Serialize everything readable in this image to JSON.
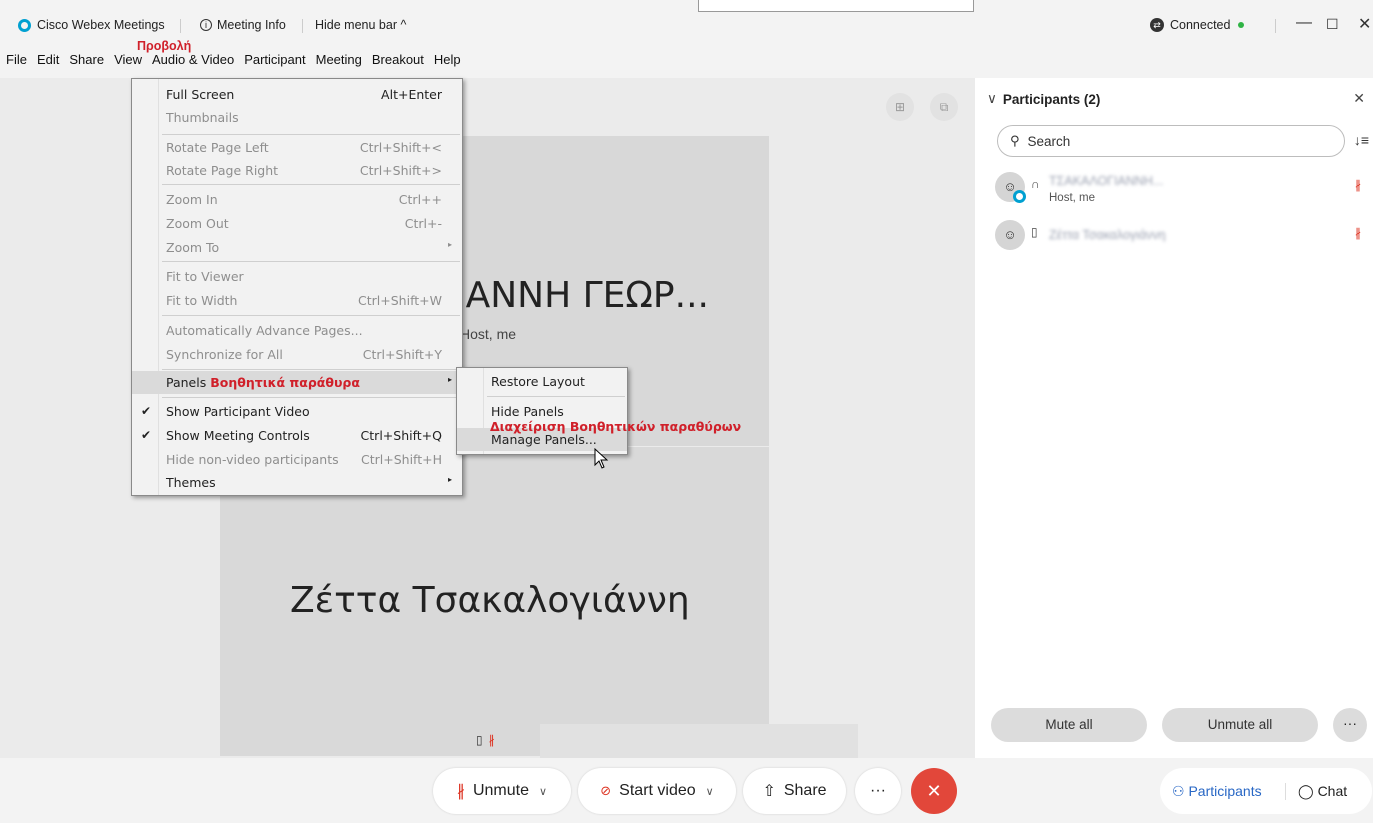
{
  "titlebar": {
    "app_name": "Cisco Webex Meetings",
    "meeting_info": "Meeting Info",
    "hide_menu_bar": "Hide menu bar",
    "hide_menu_chevron": "^",
    "connection_status": "Connected",
    "status_color": "#2fb344",
    "brand_color": "#00a0d1"
  },
  "annotation_view": "Προβολή",
  "menubar": {
    "items": [
      "File",
      "Edit",
      "Share",
      "View",
      "Audio & Video",
      "Participant",
      "Meeting",
      "Breakout",
      "Help"
    ]
  },
  "view_menu": {
    "full_screen": {
      "label": "Full Screen",
      "shortcut": "Alt+Enter"
    },
    "thumbnails": {
      "label": "Thumbnails"
    },
    "rotate_left": {
      "label": "Rotate Page Left",
      "shortcut": "Ctrl+Shift+<"
    },
    "rotate_right": {
      "label": "Rotate Page Right",
      "shortcut": "Ctrl+Shift+>"
    },
    "zoom_in": {
      "label": "Zoom In",
      "shortcut": "Ctrl++"
    },
    "zoom_out": {
      "label": "Zoom Out",
      "shortcut": "Ctrl+-"
    },
    "zoom_to": {
      "label": "Zoom To"
    },
    "fit_viewer": {
      "label": "Fit to Viewer"
    },
    "fit_width": {
      "label": "Fit to Width",
      "shortcut": "Ctrl+Shift+W"
    },
    "auto_advance": {
      "label": "Automatically Advance Pages..."
    },
    "synchronize": {
      "label": "Synchronize for All",
      "shortcut": "Ctrl+Shift+Y"
    },
    "panels": {
      "label": "Panels",
      "annotation": "Βοηθητικά παράθυρα"
    },
    "show_video": {
      "label": "Show Participant Video"
    },
    "show_controls": {
      "label": "Show Meeting Controls",
      "shortcut": "Ctrl+Shift+Q"
    },
    "hide_nonvideo": {
      "label": "Hide non-video participants",
      "shortcut": "Ctrl+Shift+H"
    },
    "themes": {
      "label": "Themes"
    }
  },
  "panels_submenu": {
    "restore_layout": "Restore Layout",
    "hide_panels": "Hide Panels",
    "manage_panels": "Manage Panels...",
    "annotation": "Διαχείριση Βοηθητικών παραθύρων"
  },
  "stage": {
    "host_name": "ΙΑΝΝΗ ΓΕΩΡ...",
    "host_role": "Host, me",
    "second_name": "Ζέττα Τσακαλογιάννη"
  },
  "participants": {
    "title": "Participants (2)",
    "search_placeholder": "Search",
    "list": [
      {
        "name": "ΤΣΑΚΑΛΟΓΙΑΝΝΗ...",
        "role": "Host, me"
      },
      {
        "name": "Ζέττα Τσακαλογιάννη",
        "role": ""
      }
    ],
    "mute_all": "Mute all",
    "unmute_all": "Unmute all",
    "more": "···"
  },
  "controls": {
    "unmute": "Unmute",
    "start_video": "Start video",
    "share": "Share",
    "more": "···",
    "end": "✕",
    "end_color": "#e2473a",
    "participants_tab": "Participants",
    "chat_tab": "Chat"
  }
}
